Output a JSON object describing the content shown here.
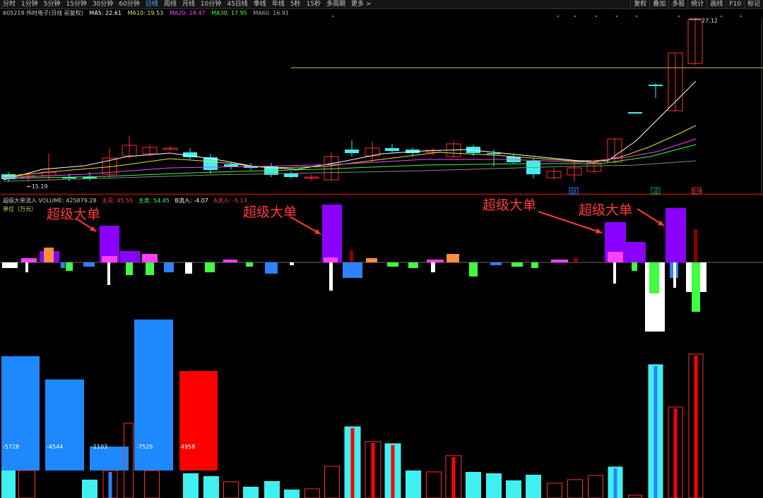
{
  "toolbar": {
    "items": [
      "分时",
      "1分钟",
      "5分钟",
      "15分钟",
      "30分钟",
      "60分钟",
      "日线",
      "周线",
      "月线",
      "10分钟",
      "45日线",
      "季线",
      "年线",
      "5秒",
      "15秒",
      "多周期",
      "更多 >"
    ],
    "active": "日线",
    "right_items": [
      "复权",
      "叠加",
      "多股",
      "统计",
      "画线",
      "F10",
      "标记"
    ]
  },
  "stock_info": {
    "code_name": "605218 伟时电子(日线 前复权)",
    "ma5": "MA5: 22.61",
    "ma10": "MA10: 19.53",
    "ma20": "MA20: 18.47",
    "ma30": "MA30: 17.95",
    "ma60": "MA60: 16.91"
  },
  "price_labels": {
    "high": "27.12",
    "low": "←15.19"
  },
  "event_markers": [
    "财",
    "减",
    "涨停"
  ],
  "indicator": {
    "title": "超级大单流入 VOLUME: 425879.28",
    "main_buy": "主买: 45.55",
    "main_sell": "主卖: 54.45",
    "b_inflow": "B流入: -4.07",
    "a_inflow": "A流入: -5.13"
  },
  "unit_label": "单位（万元）",
  "annotations": [
    "超级大单",
    "超级大单",
    "超级大单",
    "超级大单"
  ],
  "bar_values": [
    "-5728",
    "-4544",
    "-1103",
    "-7529",
    "4958"
  ],
  "colors": {
    "up": "#ff3030",
    "down": "#40f0f0",
    "ma5": "#ffffff",
    "ma10": "#e8e040",
    "ma20": "#ff40ff",
    "ma30": "#40ff40",
    "ma60": "#888888",
    "super_big": "#8a00ff",
    "annotation": "#ff3b3b"
  }
}
